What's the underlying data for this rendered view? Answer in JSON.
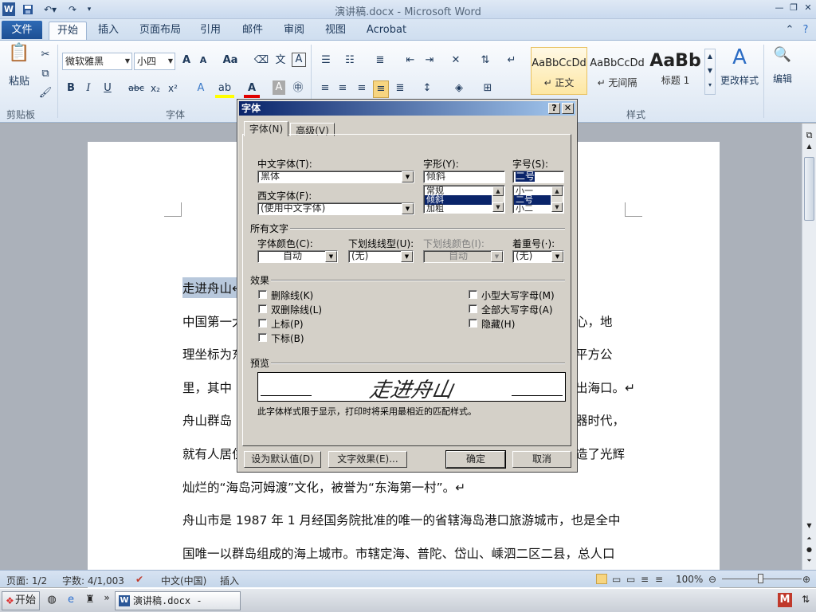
{
  "titlebar": {
    "title": "演讲稿.docx - Microsoft Word",
    "word_icon": "W",
    "save_icon": "save-icon",
    "undo_icon": "undo-icon",
    "redo_icon": "redo-icon"
  },
  "window_controls": {
    "minimize": "—",
    "restore": "❐",
    "close": "✕"
  },
  "ribbon_tabs": {
    "file": "文件",
    "home": "开始",
    "insert": "插入",
    "layout": "页面布局",
    "references": "引用",
    "mailings": "邮件",
    "review": "审阅",
    "view": "视图",
    "acrobat": "Acrobat"
  },
  "clipboard": {
    "paste": "粘贴",
    "group": "剪贴板"
  },
  "font_group": {
    "font_name": "微软雅黑",
    "font_size": "小四",
    "group": "字体",
    "grow": "A",
    "shrink": "A",
    "change_case": "Aa",
    "bold": "B",
    "italic": "I",
    "underline": "U",
    "strike": "abc",
    "sub": "x₂",
    "sup": "x²"
  },
  "styles": {
    "group": "样式",
    "items": [
      {
        "sample": "AaBbCcDd",
        "name": "↵ 正文"
      },
      {
        "sample": "AaBbCcDd",
        "name": "↵ 无间隔"
      },
      {
        "sample": "AaBb",
        "name": "标题 1"
      }
    ],
    "change_styles": "更改样式",
    "edit": "编辑"
  },
  "document": {
    "lines": [
      "走进舟山↵",
      "中国第一大",
      "心，地",
      "理坐标为东",
      "平方公",
      "里，其中",
      "出海口。↵",
      "舟山群岛",
      "器时代，",
      "就有人居住",
      "造了光辉",
      "灿烂的“海岛河姆渡”文化，被誉为“东海第一村”。↵",
      "舟山市是 1987 年 1 月经国务院批准的唯一的省辖海岛港口旅游城市，也是全中",
      "国唯一以群岛组成的海上城市。市辖定海、普陀、岱山、嵊泗二区二县，总人口"
    ]
  },
  "dialog": {
    "title": "字体",
    "help": "?",
    "close": "✕",
    "tabs": {
      "font": "字体(N)",
      "advanced": "高级(V)"
    },
    "labels": {
      "cn_font": "中文字体(T):",
      "style": "字形(Y):",
      "size": "字号(S):",
      "west_font": "西文字体(F):",
      "all_text": "所有文字",
      "color": "字体颜色(C):",
      "underline_type": "下划线线型(U):",
      "underline_color": "下划线颜色(I):",
      "emphasis": "着重号(·):",
      "effects": "效果",
      "preview": "预览"
    },
    "values": {
      "cn_font": "黑体",
      "style": "倾斜",
      "size": "二号",
      "west_font": "(使用中文字体)",
      "color": "自动",
      "underline_type": "(无)",
      "underline_color": "自动",
      "emphasis": "(无)"
    },
    "style_list": [
      "常规",
      "倾斜",
      "加粗"
    ],
    "size_list": [
      "小一",
      "二号",
      "小二"
    ],
    "effects_left": [
      "删除线(K)",
      "双删除线(L)",
      "上标(P)",
      "下标(B)"
    ],
    "effects_right": [
      "小型大写字母(M)",
      "全部大写字母(A)",
      "隐藏(H)"
    ],
    "preview_text": "走进舟山",
    "preview_note": "此字体样式限于显示，打印时将采用最相近的匹配样式。",
    "buttons": {
      "default": "设为默认值(D)",
      "text_effects": "文字效果(E)...",
      "ok": "确定",
      "cancel": "取消"
    }
  },
  "statusbar": {
    "page": "页面: 1/2",
    "words": "字数: 4/1,003",
    "language": "中文(中国)",
    "mode": "插入",
    "zoom": "100%"
  },
  "taskbar": {
    "start": "开始",
    "window": "演讲稿.docx - Micro...",
    "chevron": "»"
  }
}
